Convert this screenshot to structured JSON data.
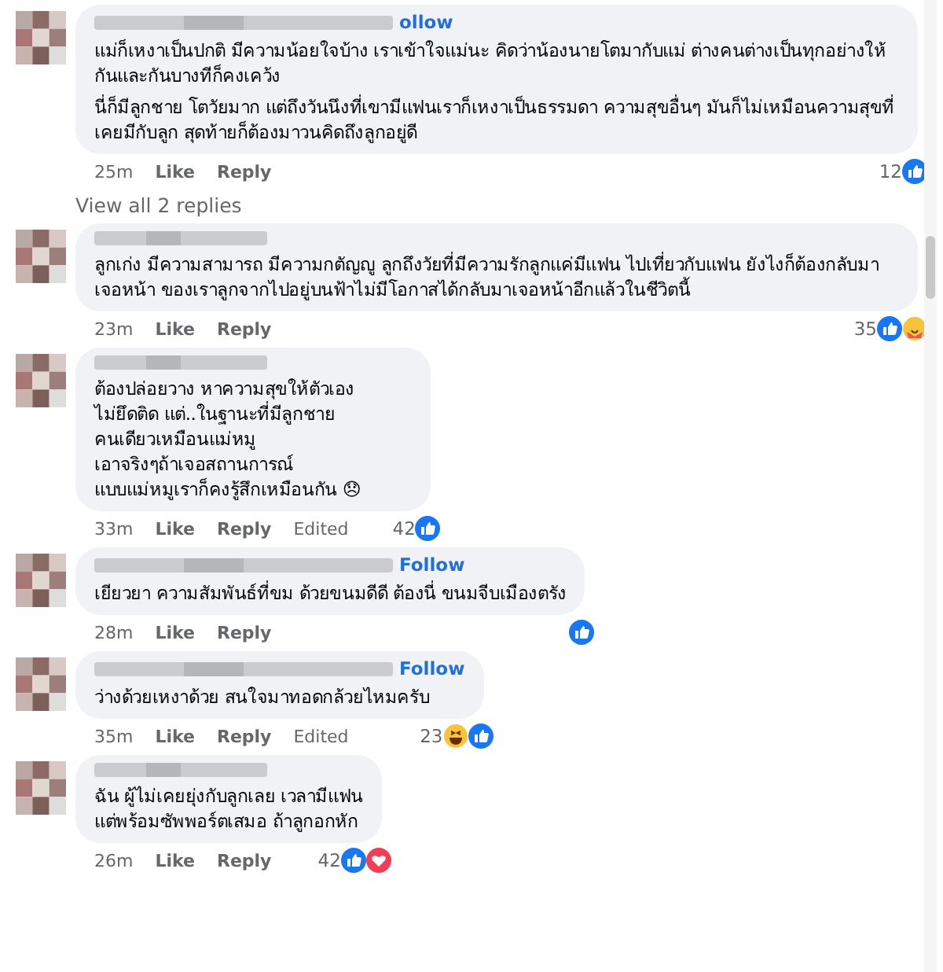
{
  "comments": [
    {
      "follow": "ollow",
      "paragraphs": [
        "แม่ก็เหงาเป็นปกติ มีความน้อยใจบ้าง เราเข้าใจแม่นะ คิดว่าน้องนายโตมากับแม่ ต่างคนต่างเป็นทุกอย่างให้กันและกันบางทีก็คงเคว้ง",
        "นี่ก็มีลูกชาย โตวัยมาก แต่ถึงวันนึงที่เขามีแฟนเราก็เหงาเป็นธรรมดา ความสุขอื่นๆ มันก็ไม่เหมือนความสุขที่เคยมีกับลูก สุดท้ายก็ต้องมาวนคิดถึงลูกอยู่ดี"
      ],
      "time": "25m",
      "like": "Like",
      "reply": "Reply",
      "count": "12",
      "reactions": [
        {
          "kind": "like"
        }
      ],
      "view_replies": "View all 2 replies"
    },
    {
      "paragraphs": [
        "ลูกเก่ง มีความสามารถ มีความกตัญญู ลูกถึงวัยที่มีความรักลูกแค่มีแฟน ไปเที่ยวกับแฟน ยังไงก็ต้องกลับมาเจอหน้า ของเราลูกจากไปอยู่บนฟ้าไม่มีโอกาสได้กลับมาเจอหน้าอีกแล้วในชีวิตนี้"
      ],
      "time": "23m",
      "like": "Like",
      "reply": "Reply",
      "count": "35",
      "reactions": [
        {
          "kind": "like"
        },
        {
          "kind": "care"
        }
      ]
    },
    {
      "paragraphs": [
        "ต้องปล่อยวาง หาความสุขให้ตัวเอง\nไม่ยึดติด แต่..ในฐานะที่มีลูกชาย\nคนเดียวเหมือนแม่หมู\nเอาจริงๆถ้าเจอสถานการณ์\nแบบแม่หมูเราก็คงรู้สึกเหมือนกัน 😞"
      ],
      "time": "33m",
      "like": "Like",
      "reply": "Reply",
      "edited": "Edited",
      "count": "42",
      "reactions": [
        {
          "kind": "like"
        }
      ]
    },
    {
      "follow": "Follow",
      "paragraphs": [
        "เยียวยา ความสัมพันธ์ที่ขม ด้วยขนมดีดี ต้องนี่ ขนมจีบเมืองตรัง"
      ],
      "time": "28m",
      "like": "Like",
      "reply": "Reply",
      "reactions": [
        {
          "kind": "like"
        }
      ]
    },
    {
      "follow": "Follow",
      "paragraphs": [
        "ว่างด้วยเหงาด้วย สนใจมาทอดกล้วยไหมครับ"
      ],
      "time": "35m",
      "like": "Like",
      "reply": "Reply",
      "edited": "Edited",
      "count": "23",
      "reactions": [
        {
          "kind": "haha"
        },
        {
          "kind": "like"
        }
      ]
    },
    {
      "paragraphs": [
        "ฉัน ผู้ไม่เคยยุ่งกับลูกเลย เวลามีแฟน\nแต่พร้อมซัพพอร์ตเสมอ ถ้าลูกอกหัก"
      ],
      "time": "26m",
      "like": "Like",
      "reply": "Reply",
      "count": "42",
      "reactions": [
        {
          "kind": "like"
        },
        {
          "kind": "love"
        }
      ]
    }
  ]
}
